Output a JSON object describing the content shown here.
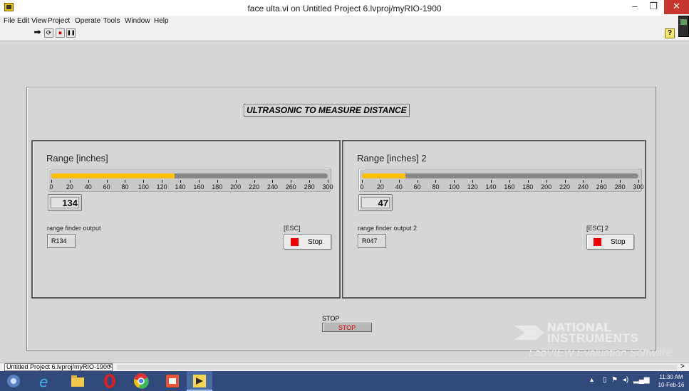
{
  "window": {
    "title": "face ulta.vi on Untitled Project 6.lvproj/myRIO-1900",
    "min_glyph": "–",
    "max_glyph": "❐",
    "close_glyph": "✕"
  },
  "menu": [
    "File",
    "Edit",
    "View",
    "Project",
    "Operate",
    "Tools",
    "Window",
    "Help"
  ],
  "toolbar": {
    "run": "➡",
    "run_continuous": "⟳",
    "abort": "⏹",
    "pause": "❚❚",
    "help": "?"
  },
  "front_panel": {
    "heading": "ULTRASONIC TO MEASURE DISTANCE",
    "scale_ticks": [
      "0",
      "20",
      "40",
      "60",
      "80",
      "100",
      "120",
      "140",
      "160",
      "180",
      "200",
      "220",
      "240",
      "260",
      "280",
      "300"
    ],
    "scale_max": 300,
    "left": {
      "range_label": "Range [inches]",
      "value": 134,
      "value_text": "134",
      "rf_label": "range finder output",
      "rf_value": "R134",
      "esc_label": "[ESC]",
      "stop_label": "Stop"
    },
    "right": {
      "range_label": "Range [inches] 2",
      "value": 47,
      "value_text": "47",
      "rf_label": "range finder output 2",
      "rf_value": "R047",
      "esc_label": "[ESC] 2",
      "stop_label": "Stop"
    },
    "main_stop_label": "STOP",
    "main_stop_button": "STOP"
  },
  "ni_logo": {
    "line1": "NATIONAL",
    "line2": "INSTRUMENTS",
    "line3": "LabVIEW  Evaluation Software"
  },
  "statusbar": {
    "project_path": "Untitled Project 6.lvproj/myRIO-1900",
    "left_arrow": "<",
    "right_arrow": ">"
  },
  "taskbar": {
    "time": "11:30 AM",
    "date": "10-Feb-16"
  },
  "colors": {
    "bar_fill": "#ffc000",
    "led_red": "#f00000",
    "taskbar": "#304a7b"
  }
}
